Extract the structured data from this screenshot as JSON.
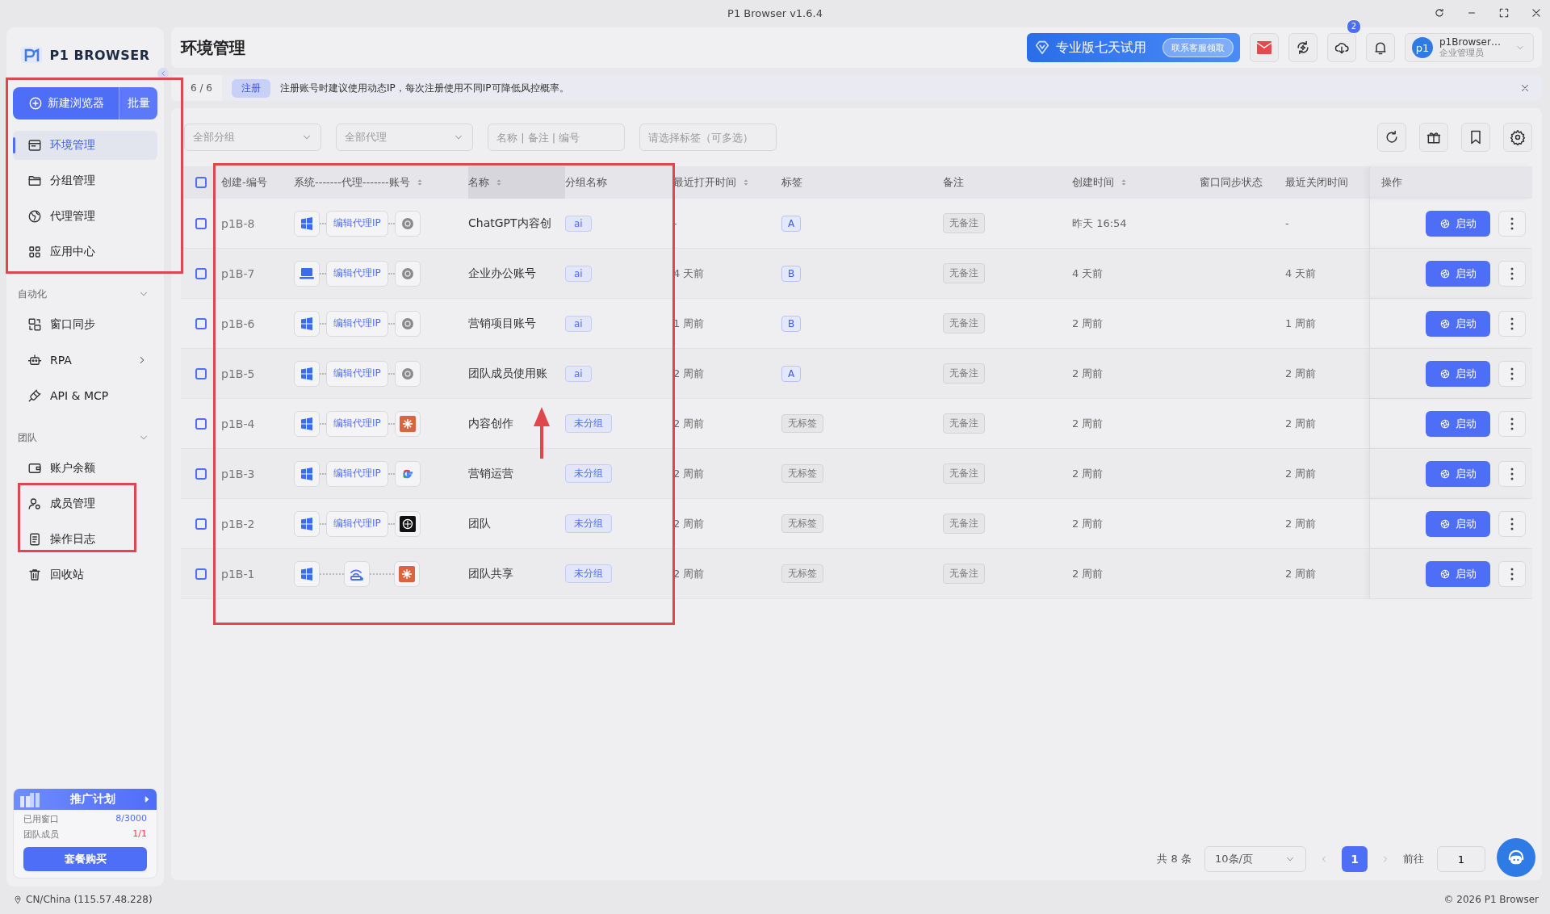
{
  "window": {
    "title": "P1 Browser v1.6.4"
  },
  "sidebar": {
    "brand": "P1 BROWSER",
    "new_button": "新建浏览器",
    "batch_button": "批量",
    "nav": [
      {
        "kind": "item",
        "label": "环境管理",
        "selected": true,
        "submenu": false
      },
      {
        "kind": "item",
        "label": "分组管理",
        "selected": false,
        "submenu": false
      },
      {
        "kind": "item",
        "label": "代理管理",
        "selected": false,
        "submenu": false
      },
      {
        "kind": "item",
        "label": "应用中心",
        "selected": false,
        "submenu": false
      },
      {
        "kind": "section",
        "label": "自动化",
        "expanded": true
      },
      {
        "kind": "item",
        "label": "窗口同步",
        "selected": false,
        "submenu": false
      },
      {
        "kind": "item",
        "label": "RPA",
        "selected": false,
        "submenu": true
      },
      {
        "kind": "item",
        "label": "API & MCP",
        "selected": false,
        "submenu": false
      },
      {
        "kind": "section",
        "label": "团队",
        "expanded": true
      },
      {
        "kind": "item",
        "label": "账户余额",
        "selected": false,
        "submenu": false
      },
      {
        "kind": "item",
        "label": "成员管理",
        "selected": false,
        "submenu": false
      },
      {
        "kind": "item",
        "label": "操作日志",
        "selected": false,
        "submenu": false
      },
      {
        "kind": "item",
        "label": "回收站",
        "selected": false,
        "submenu": false
      }
    ],
    "promo": {
      "title": "推广计划",
      "stats": [
        {
          "label": "已用窗口",
          "value": "8/3000",
          "color": "#4f6ef7"
        },
        {
          "label": "团队成员",
          "value": "1/1",
          "color": "#e5484d"
        }
      ],
      "button": "套餐购买"
    }
  },
  "header": {
    "title": "环境管理",
    "trial": {
      "text": "专业版七天试用",
      "button": "联系客服领取"
    },
    "download_badge": "2",
    "user": {
      "avatar": "p1",
      "name": "p1Browser…",
      "role": "企业管理员"
    }
  },
  "notice": {
    "count": "6 / 6",
    "tag": "注册",
    "text": "注册账号时建议使用动态IP，每次注册使用不同IP可降低风控概率。"
  },
  "filters": {
    "group": "全部分组",
    "proxy": "全部代理",
    "search_placeholder": "名称 | 备注 | 编号",
    "tags_placeholder": "请选择标签（可多选）"
  },
  "table": {
    "select_all_checked": false,
    "columns": [
      {
        "label": "创建-编号",
        "sortable": false,
        "highlighted": false
      },
      {
        "label": "系统-------代理-------账号",
        "sortable": true,
        "highlighted": false
      },
      {
        "label": "名称",
        "sortable": true,
        "highlighted": true
      },
      {
        "label": "分组名称",
        "sortable": false,
        "highlighted": false
      },
      {
        "label": "最近打开时间",
        "sortable": true,
        "highlighted": false
      },
      {
        "label": "标签",
        "sortable": false,
        "highlighted": false
      },
      {
        "label": "备注",
        "sortable": false,
        "highlighted": false
      },
      {
        "label": "创建时间",
        "sortable": true,
        "highlighted": false
      },
      {
        "label": "窗口同步状态",
        "sortable": false,
        "highlighted": false
      },
      {
        "label": "最近关闭时间",
        "sortable": false,
        "highlighted": false
      },
      {
        "label": "操作",
        "sortable": false,
        "highlighted": false
      }
    ],
    "rows": [
      {
        "checked": false,
        "id": "p1B-8",
        "os": {
          "kind": "windows"
        },
        "proxy": {
          "kind": "button",
          "label": "编辑代理IP"
        },
        "account": {
          "kind": "flower"
        },
        "name": "ChatGPT内容创",
        "group": "ai",
        "tag": {
          "text": "A",
          "empty": false
        },
        "note": "无备注",
        "last_opened": "-",
        "created": "昨天 16:54",
        "last_closed": "-",
        "action": "启动"
      },
      {
        "checked": false,
        "id": "p1B-7",
        "os": {
          "kind": "laptop"
        },
        "proxy": {
          "kind": "button",
          "label": "编辑代理IP"
        },
        "account": {
          "kind": "flower"
        },
        "name": "企业办公账号",
        "group": "ai",
        "tag": {
          "text": "B",
          "empty": false
        },
        "note": "无备注",
        "last_opened": "4 天前",
        "created": "4 天前",
        "last_closed": "4 天前",
        "action": "启动"
      },
      {
        "checked": false,
        "id": "p1B-6",
        "os": {
          "kind": "windows"
        },
        "proxy": {
          "kind": "button",
          "label": "编辑代理IP"
        },
        "account": {
          "kind": "flower"
        },
        "name": "营销项目账号",
        "group": "ai",
        "tag": {
          "text": "B",
          "empty": false
        },
        "note": "无备注",
        "last_opened": "1 周前",
        "created": "2 周前",
        "last_closed": "1 周前",
        "action": "启动"
      },
      {
        "checked": false,
        "id": "p1B-5",
        "os": {
          "kind": "windows"
        },
        "proxy": {
          "kind": "button",
          "label": "编辑代理IP"
        },
        "account": {
          "kind": "flower"
        },
        "name": "团队成员使用账",
        "group": "ai",
        "tag": {
          "text": "A",
          "empty": false
        },
        "note": "无备注",
        "last_opened": "2 周前",
        "created": "2 周前",
        "last_closed": "2 周前",
        "action": "启动"
      },
      {
        "checked": false,
        "id": "p1B-4",
        "os": {
          "kind": "windows"
        },
        "proxy": {
          "kind": "button",
          "label": "编辑代理IP"
        },
        "account": {
          "kind": "burst"
        },
        "name": "内容创作",
        "group": "未分组",
        "tag": {
          "text": "无标签",
          "empty": true
        },
        "note": "无备注",
        "last_opened": "2 周前",
        "created": "2 周前",
        "last_closed": "2 周前",
        "action": "启动"
      },
      {
        "checked": false,
        "id": "p1B-3",
        "os": {
          "kind": "windows"
        },
        "proxy": {
          "kind": "button",
          "label": "编辑代理IP"
        },
        "account": {
          "kind": "g"
        },
        "name": "营销运营",
        "group": "未分组",
        "tag": {
          "text": "无标签",
          "empty": true
        },
        "note": "无备注",
        "last_opened": "2 周前",
        "created": "2 周前",
        "last_closed": "2 周前",
        "action": "启动"
      },
      {
        "checked": false,
        "id": "p1B-2",
        "os": {
          "kind": "windows"
        },
        "proxy": {
          "kind": "button",
          "label": "编辑代理IP"
        },
        "account": {
          "kind": "dark"
        },
        "name": "团队",
        "group": "未分组",
        "tag": {
          "text": "无标签",
          "empty": true
        },
        "note": "无备注",
        "last_opened": "2 周前",
        "created": "2 周前",
        "last_closed": "2 周前",
        "action": "启动"
      },
      {
        "checked": false,
        "id": "p1B-1",
        "os": {
          "kind": "windows"
        },
        "proxy": {
          "kind": "local"
        },
        "account": {
          "kind": "burst"
        },
        "name": "团队共享",
        "group": "未分组",
        "tag": {
          "text": "无标签",
          "empty": true
        },
        "note": "无备注",
        "last_opened": "2 周前",
        "created": "2 周前",
        "last_closed": "2 周前",
        "action": "启动"
      }
    ]
  },
  "pagination": {
    "total": "共 8 条",
    "page_size": "10条/页",
    "pages": [
      {
        "label": "1",
        "selected": true
      }
    ],
    "goto_label": "前往",
    "goto_value": "1"
  },
  "footer": {
    "location": "CN/China (115.57.48.228)",
    "copyright": "© 2026 P1 Browser"
  }
}
